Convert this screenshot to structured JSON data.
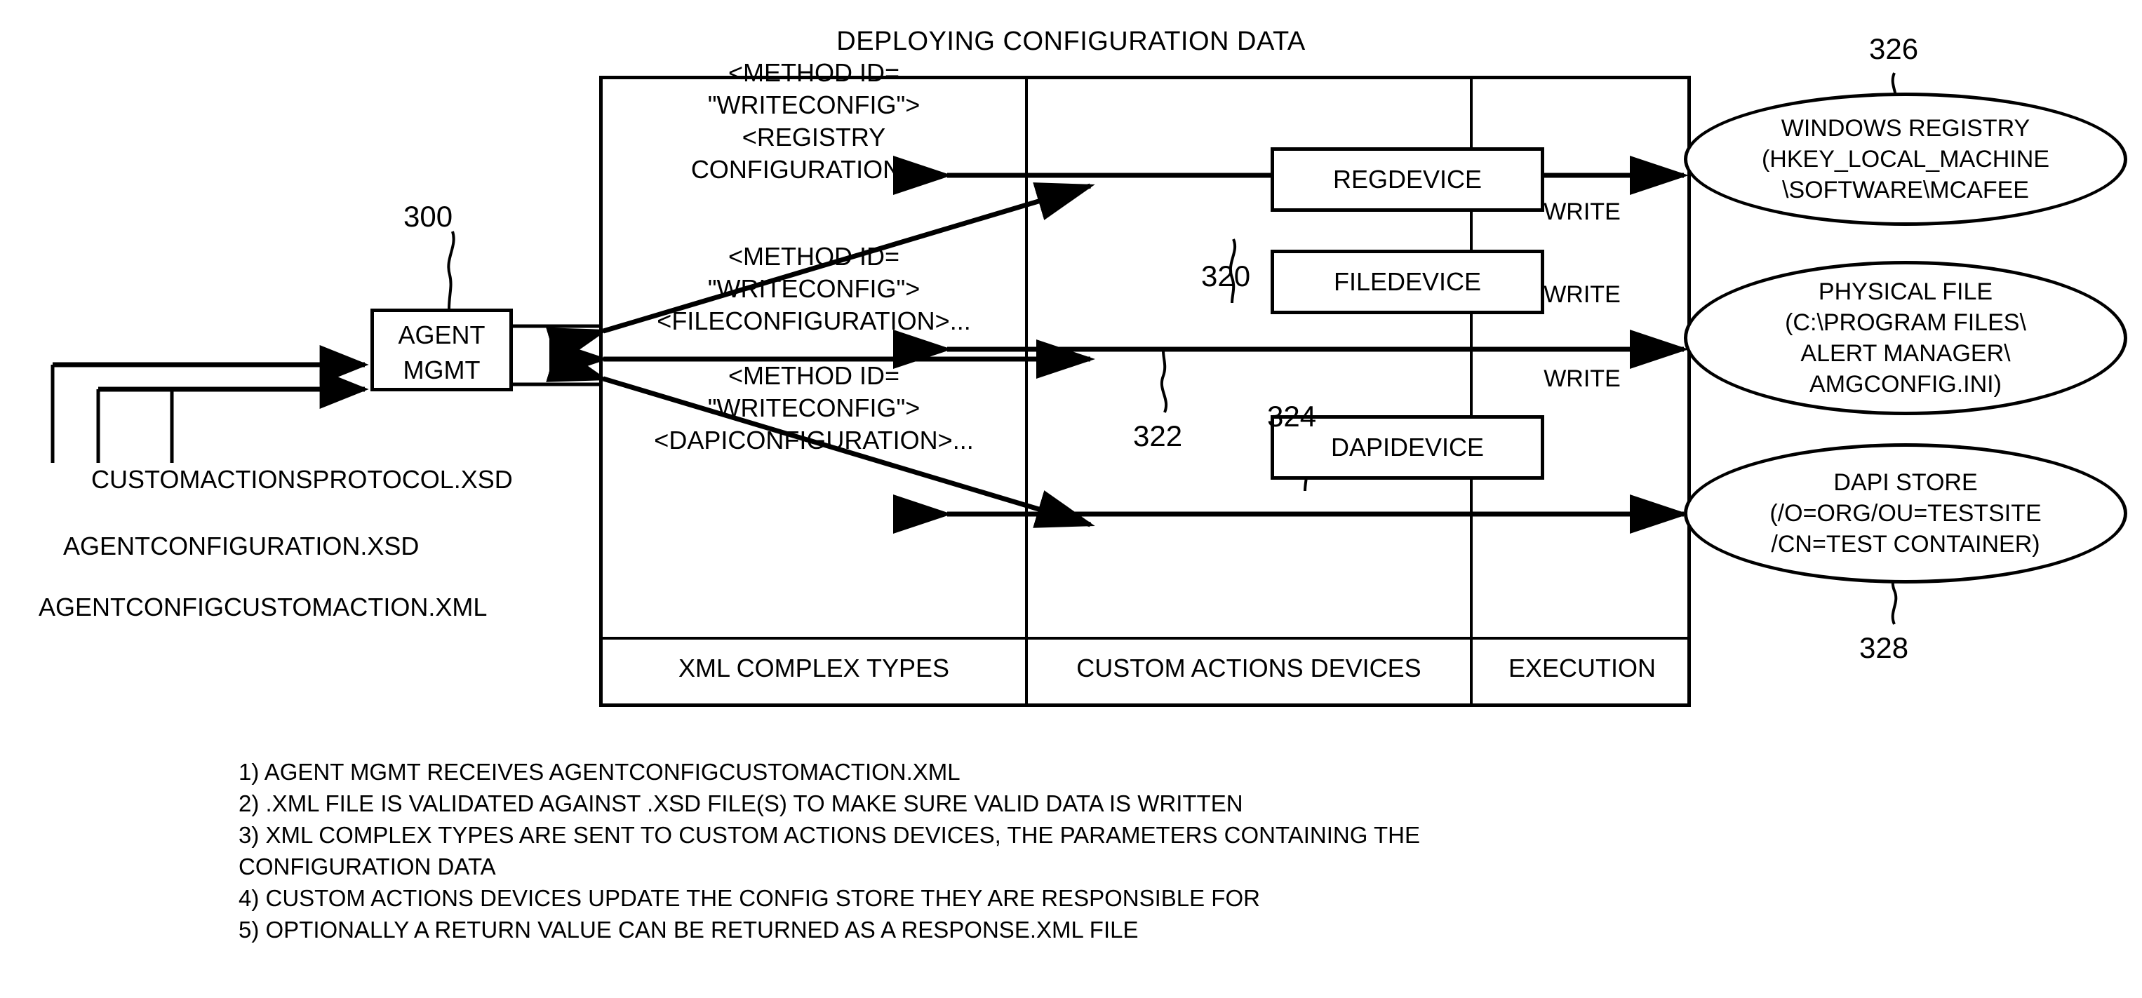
{
  "figure": {
    "title": "DEPLOYING CONFIGURATION DATA"
  },
  "agent": {
    "line1": "AGENT",
    "line2": "MGMT",
    "callout": "300"
  },
  "inputs": [
    {
      "label": "CUSTOMACTIONSPROTOCOL.XSD"
    },
    {
      "label": "AGENTCONFIGURATION.XSD"
    },
    {
      "label": "AGENTCONFIGCUSTOMACTION.XML"
    }
  ],
  "columns": {
    "xml_complex_types": "XML COMPLEX TYPES",
    "custom_actions_devices": "CUSTOM ACTIONS DEVICES",
    "execution": "EXECUTION"
  },
  "xml_blocks": {
    "registry": {
      "line1": "<METHOD ID=",
      "line2": "\"WRITECONFIG\">",
      "line3": "<REGISTRY",
      "line4": "CONFIGURATION>..."
    },
    "file": {
      "line1": "<METHOD ID=",
      "line2": "\"WRITECONFIG\">",
      "line3": "<FILECONFIGURATION>..."
    },
    "dapi": {
      "line1": "<METHOD ID=",
      "line2": "\"WRITECONFIG\">",
      "line3": "<DAPICONFIGURATION>..."
    }
  },
  "devices": [
    {
      "label": "REGDEVICE",
      "callout": "320"
    },
    {
      "label": "FILEDEVICE",
      "callout": "322"
    },
    {
      "label": "DAPIDEVICE",
      "callout": "324"
    }
  ],
  "execution": {
    "write_1": "WRITE",
    "write_2": "WRITE",
    "write_3": "WRITE"
  },
  "stores": {
    "windows_registry": {
      "line1": "WINDOWS REGISTRY",
      "line2": "(HKEY_LOCAL_MACHINE",
      "line3": "\\SOFTWARE\\MCAFEE",
      "callout": "326"
    },
    "physical_file": {
      "line1": "PHYSICAL FILE",
      "line2": "(C:\\PROGRAM FILES\\",
      "line3": "ALERT MANAGER\\",
      "line4": "AMGCONFIG.INI)"
    },
    "dapi_store": {
      "line1": "DAPI STORE",
      "line2": "(/O=ORG/OU=TESTSITE",
      "line3": "/CN=TEST CONTAINER)",
      "callout": "328"
    }
  },
  "notes": [
    "1) AGENT MGMT RECEIVES AGENTCONFIGCUSTOMACTION.XML",
    "2) .XML FILE IS VALIDATED AGAINST .XSD FILE(S) TO MAKE SURE VALID DATA IS WRITTEN",
    "3) XML COMPLEX TYPES ARE SENT TO CUSTOM ACTIONS DEVICES, THE PARAMETERS CONTAINING THE\nCONFIGURATION DATA",
    "4) CUSTOM ACTIONS DEVICES UPDATE THE CONFIG STORE THEY ARE RESPONSIBLE FOR",
    "5) OPTIONALLY A RETURN VALUE CAN BE RETURNED AS A RESPONSE.XML FILE"
  ]
}
